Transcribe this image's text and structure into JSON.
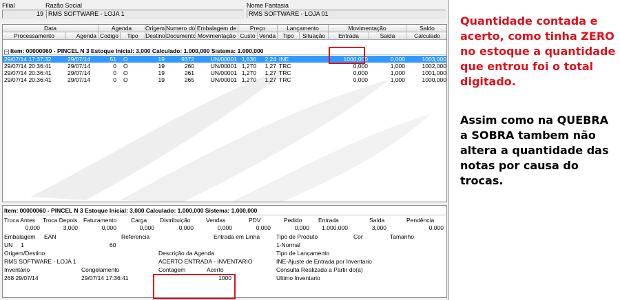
{
  "header": {
    "filial_label": "Filial",
    "razao_label": "Razão Social",
    "filial_value": "19",
    "razao_value": "RMS SOFTWARE - LOJA 1",
    "fantasia_label": "Nome Fantasia",
    "fantasia_value": "RMS SOFTWARE - LOJA 01"
  },
  "grid": {
    "groups": [
      "Data",
      "Agenda",
      "Origem/",
      "Numero do",
      "Embalagem de",
      "Preço",
      "Lançamento",
      "Movimentação",
      "Saldo"
    ],
    "columns": [
      "Processamento",
      "Agenda",
      "Codigo",
      "Tipo",
      "Destino",
      "Documento",
      "Movimentação",
      "Custo",
      "Venda",
      "Tipo",
      "Situação",
      "Entrada",
      "Saida",
      "Calculado"
    ],
    "group_row": "Item: 00000060 - PINCEL N 3  Estoque Inicial: 3,000  Calculado: 1.000,000  Sistema: 1.000,000",
    "rows": [
      [
        "29/07/14 17:37:32",
        "29/07/14",
        "51",
        "O",
        "19",
        "9372",
        "UN/00001",
        "1,630",
        "2,24",
        "INE",
        "",
        "1000,000",
        "0,000",
        "1003,000"
      ],
      [
        "29/07/14 20:36:41",
        "29/07/14",
        "0",
        "O",
        "19",
        "260",
        "UN/00001",
        "1,270",
        "1,27",
        "TRC",
        "",
        "0,000",
        "1,000",
        "1002,000"
      ],
      [
        "29/07/14 20:36:41",
        "29/07/14",
        "0",
        "O",
        "19",
        "261",
        "UN/00001",
        "1,270",
        "1,27",
        "TRC",
        "",
        "0,000",
        "1,000",
        "1001,000"
      ],
      [
        "29/07/14 20:36:41",
        "29/07/14",
        "0",
        "O",
        "19",
        "265",
        "UN/00001",
        "1,270",
        "1,27",
        "TRC",
        "",
        "0,000",
        "1,000",
        "1000,000"
      ]
    ]
  },
  "detail": {
    "title": "Item: 00000060 - PINCEL N 3  Estoque Inicial: 3,000  Calculado: 1.000,000  Sistema: 1.000,000",
    "totals_labels": [
      "Troca Antes",
      "Troca Depois",
      "Faturamento",
      "Carga",
      "Distribuição",
      "Vendas",
      "PDV",
      "Pedido",
      "Entrada",
      "Saída",
      "Pendência"
    ],
    "totals_values": [
      "0,000",
      "3,000",
      "0,000",
      "0,000",
      "0,000",
      "0,000",
      "0,000",
      "0,000",
      "1.000,000",
      "3,000",
      "0,000"
    ],
    "embalagem_label": "Embalagem",
    "ean_label": "EAN",
    "referencia_label": "Referencia",
    "entrada_linha_label": "Entrada em Linha",
    "tipo_produto_label": "Tipo de Produto",
    "cor_label": "Cor",
    "tamanho_label": "Tamanho",
    "embalagem_value": "UN",
    "ean_value": "1",
    "referencia_value": "60",
    "tipo_produto_value": "1-Normal",
    "origem_label": "Origem/Destino",
    "desc_agenda_label": "Descrição da Agenda",
    "tipo_lanc_label": "Tipo de Lançamento",
    "origem_value": "RMS SOFTWARE - LOJA 1",
    "desc_agenda_value": "ACERTO ENTRADA - INVENTARIO",
    "tipo_lanc_value": "INE-Ajuste de Entrada por Inventario",
    "inventario_label": "Inventário",
    "congelamento_label": "Congelamento",
    "contagem_label": "Contagem",
    "acerto_label": "Acerto",
    "consulta_label": "Consulta Realizada a Partir do(a)",
    "inventario_value": "268 29/07/14",
    "congelamento_value": "29/07/14 17:36:41",
    "acerto_value": "1000",
    "consulta_value": "Ultimo Inventario"
  },
  "annotation": {
    "color": "#e0101a",
    "red_lines": [
      "Quantidade contada e",
      "acerto, como tinha ZERO",
      "no estoque a quantidade",
      "que entrou foi o total",
      "digitado."
    ],
    "black_lines": [
      "Assim como na QUEBRA",
      "a SOBRA tambem não",
      "altera a quantidade das",
      "notas por causa do",
      "trocas."
    ]
  }
}
